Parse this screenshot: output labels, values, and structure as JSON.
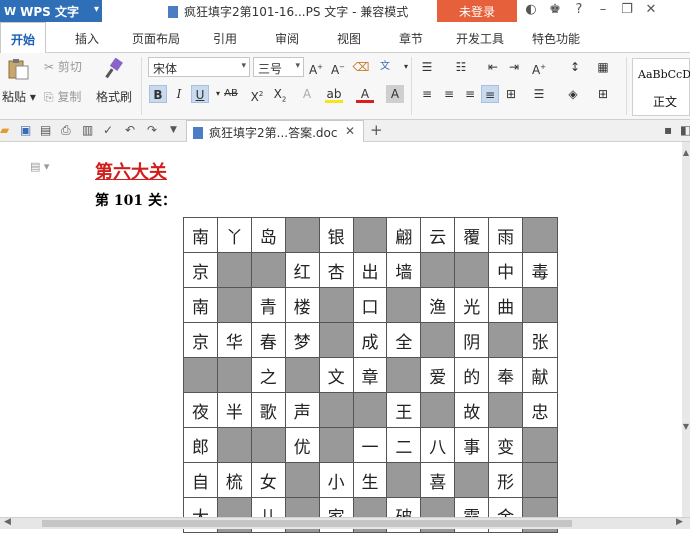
{
  "titlebar": {
    "app_name": "WPS 文字",
    "doc_title": "疯狂填字2第101-16...PS 文字 - 兼容模式",
    "login_label": "未登录",
    "icons": [
      "skin-icon",
      "shirt-icon",
      "help-icon",
      "minimize-icon",
      "restore-icon",
      "close-icon"
    ]
  },
  "menu": {
    "tabs": [
      "开始",
      "插入",
      "页面布局",
      "引用",
      "审阅",
      "视图",
      "章节",
      "开发工具",
      "特色功能"
    ]
  },
  "ribbon": {
    "paste_label": "粘贴",
    "cut_label": "剪切",
    "copy_label": "复制",
    "format_painter_label": "格式刷",
    "font_name": "宋体",
    "font_size": "三号",
    "style_sample": "AaBbCcDd",
    "style_name": "正文"
  },
  "doc_tab": {
    "title": "疯狂填字2第...答案.doc"
  },
  "document": {
    "heading": "第六大关",
    "level_label": "第 101 关：",
    "grid": [
      [
        "南",
        "丫",
        "岛",
        "#",
        "银",
        "#",
        "翩",
        "云",
        "覆",
        "雨",
        "#"
      ],
      [
        "京",
        "#",
        "#",
        "红",
        "杏",
        "出",
        "墙",
        "#",
        "#",
        "中",
        "毒"
      ],
      [
        "南",
        "#",
        "青",
        "楼",
        "#",
        "口",
        "#",
        "渔",
        "光",
        "曲",
        "#"
      ],
      [
        "京",
        "华",
        "春",
        "梦",
        "#",
        "成",
        "全",
        "#",
        "阴",
        "#",
        "张"
      ],
      [
        "#",
        "#",
        "之",
        "#",
        "文",
        "章",
        "#",
        "爱",
        "的",
        "奉",
        "献"
      ],
      [
        "夜",
        "半",
        "歌",
        "声",
        "#",
        "#",
        "王",
        "#",
        "故",
        "#",
        "忠"
      ],
      [
        "郎",
        "#",
        "#",
        "优",
        "#",
        "一",
        "二",
        "八",
        "事",
        "变",
        "#"
      ],
      [
        "自",
        "梳",
        "女",
        "#",
        "小",
        "生",
        "#",
        "喜",
        "#",
        "形",
        "#"
      ],
      [
        "大",
        "#",
        "儿",
        "#",
        "家",
        "#",
        "破",
        "#",
        "霞",
        "金",
        "#"
      ]
    ]
  }
}
